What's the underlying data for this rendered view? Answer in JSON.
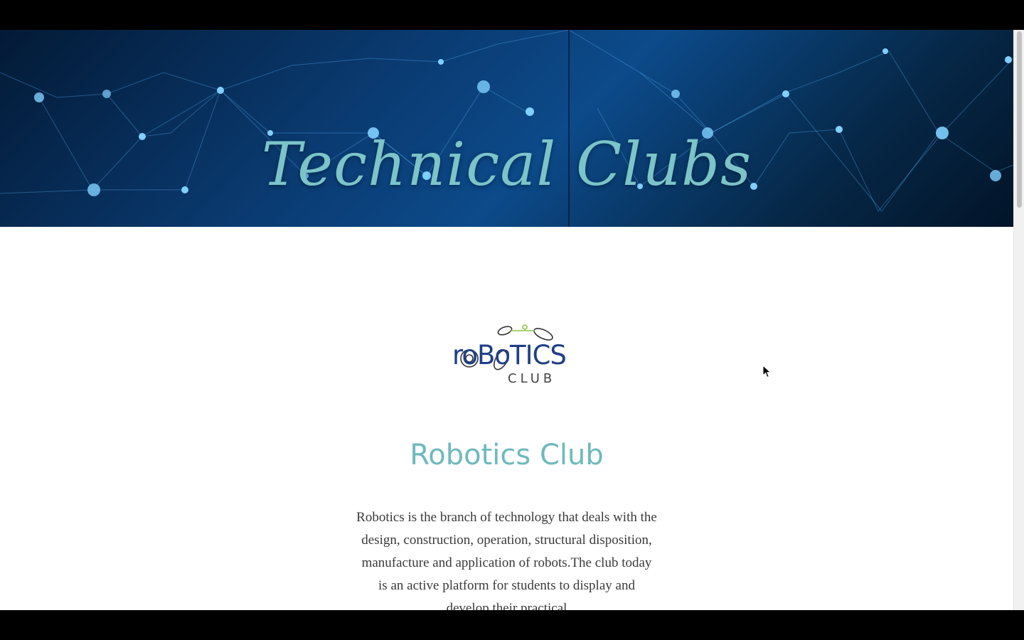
{
  "hero": {
    "title": "Technical Clubs"
  },
  "logo": {
    "word": "roBoTICS",
    "sub": "CLUB"
  },
  "club": {
    "title": "Robotics Club",
    "description": "Robotics is the branch of technology that deals with the design, construction, operation, structural disposition, manufacture and application of robots.The club today is an active platform for students to display and develop their practical"
  },
  "colors": {
    "accent": "#6fb9bd",
    "hero_bg": "#0a3a70"
  }
}
